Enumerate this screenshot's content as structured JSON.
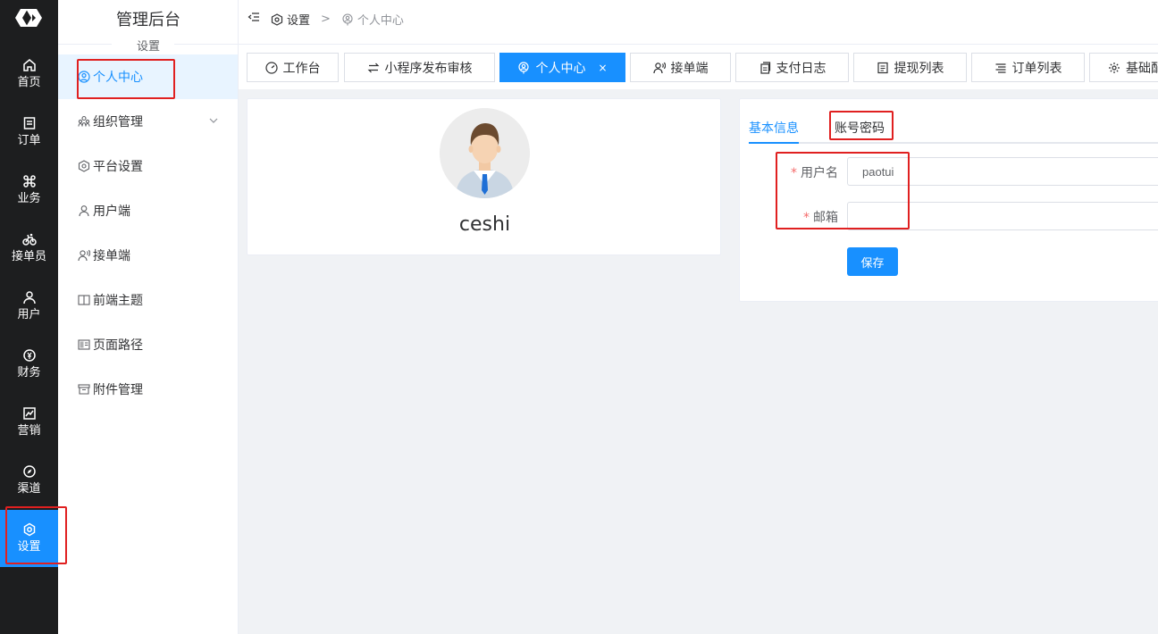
{
  "rail": {
    "items": [
      {
        "label": "首页",
        "icon": "home-icon"
      },
      {
        "label": "订单",
        "icon": "order-icon"
      },
      {
        "label": "业务",
        "icon": "command-icon"
      },
      {
        "label": "接单员",
        "icon": "bike-icon"
      },
      {
        "label": "用户",
        "icon": "user-icon"
      },
      {
        "label": "财务",
        "icon": "money-icon"
      },
      {
        "label": "营销",
        "icon": "chart-icon"
      },
      {
        "label": "渠道",
        "icon": "compass-icon"
      },
      {
        "label": "设置",
        "icon": "settings-icon"
      }
    ],
    "active_index": 8
  },
  "submenu": {
    "title": "管理后台",
    "section": "设置",
    "items": [
      {
        "label": "个人中心",
        "icon": "user-circle-icon"
      },
      {
        "label": "组织管理",
        "icon": "org-icon"
      },
      {
        "label": "平台设置",
        "icon": "hexagon-settings-icon"
      },
      {
        "label": "用户端",
        "icon": "user-icon"
      },
      {
        "label": "接单端",
        "icon": "user-voice-icon"
      },
      {
        "label": "前端主题",
        "icon": "book-icon"
      },
      {
        "label": "页面路径",
        "icon": "layout-icon"
      },
      {
        "label": "附件管理",
        "icon": "archive-icon"
      }
    ]
  },
  "breadcrumb": {
    "parent": "设置",
    "current": "个人中心"
  },
  "tabs": [
    {
      "label": "工作台",
      "icon": "dashboard-icon"
    },
    {
      "label": "小程序发布审核",
      "icon": "swap-icon"
    },
    {
      "label": "个人中心",
      "icon": "user-circle-icon",
      "close": "×"
    },
    {
      "label": "接单端",
      "icon": "user-voice-icon"
    },
    {
      "label": "支付日志",
      "icon": "copy-icon"
    },
    {
      "label": "提现列表",
      "icon": "list-icon"
    },
    {
      "label": "订单列表",
      "icon": "align-icon"
    },
    {
      "label": "基础配置",
      "icon": "gear-icon"
    }
  ],
  "profile": {
    "username": "ceshi"
  },
  "form": {
    "tabs": [
      "基本信息",
      "账号密码"
    ],
    "active_tab": 0,
    "username_label": "用户名",
    "username_value": "paotui",
    "email_label": "邮箱",
    "email_value": "",
    "required_mark": "*",
    "save_label": "保存"
  },
  "colors": {
    "primary": "#1890ff",
    "rail_bg": "#1d1e1f",
    "highlight": "#e02020"
  }
}
